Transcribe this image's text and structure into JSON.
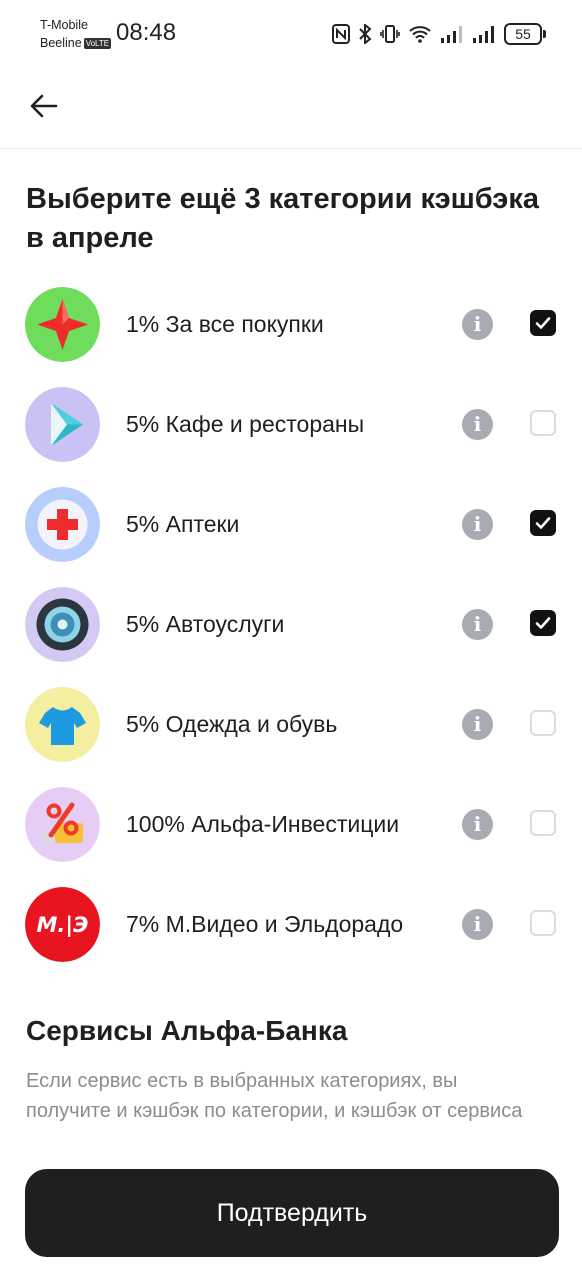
{
  "status_bar": {
    "carrier_1": "T-Mobile",
    "carrier_2": "Beeline",
    "volte_badge": "VoLTE",
    "time": "08:48",
    "battery_level": "55",
    "icons": [
      "nfc-icon",
      "bluetooth-icon",
      "vibrate-icon",
      "wifi-icon",
      "signal-icon",
      "signal-icon",
      "battery-icon"
    ]
  },
  "header": {
    "back_icon": "arrow-left-icon",
    "title": "Выберите ещё 3 категории кэшбэка в апреле"
  },
  "categories": [
    {
      "label": "1% За все покупки",
      "icon": "red-star-icon",
      "checked": true
    },
    {
      "label": "5% Кафе и рестораны",
      "icon": "play-triangle-icon",
      "checked": false
    },
    {
      "label": "5% Аптеки",
      "icon": "medical-cross-icon",
      "checked": true
    },
    {
      "label": "5% Автоуслуги",
      "icon": "car-wheel-icon",
      "checked": true
    },
    {
      "label": "5% Одежда и обувь",
      "icon": "t-shirt-icon",
      "checked": false
    },
    {
      "label": "100% Альфа-Инвестиции",
      "icon": "percent-icon",
      "checked": false
    },
    {
      "label": "7% М.Видео и Эльдорадо",
      "icon": "mvideo-eldorado-logo",
      "logo_text": "М.|Э",
      "checked": false
    }
  ],
  "info_icon": "info-icon",
  "services": {
    "title": "Сервисы Альфа-Банка",
    "description": "Если сервис есть в выбранных категориях, вы получите и кэшбэк по категории, и кэшбэк от сервиса"
  },
  "confirm_button": {
    "label": "Подтвердить"
  },
  "colors": {
    "accent_dark": "#1f1f20",
    "info_gray": "#a8abb2",
    "muted_text": "#8a8c91",
    "checkbox_border": "#dcdcdc"
  }
}
